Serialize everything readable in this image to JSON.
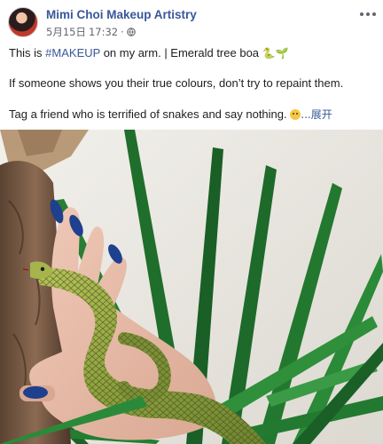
{
  "post": {
    "author": "Mimi Choi Makeup Artistry",
    "date": "5月15日",
    "time": "17:32",
    "separator": "·",
    "more_icon": "more-horizontal-icon",
    "privacy_icon": "globe-icon",
    "caption": {
      "line1_prefix": "This is ",
      "hashtag": "#MAKEUP",
      "line1_suffix": " on my arm. | Emerald tree boa ",
      "line1_emoji": "🐍🌱",
      "line2": "If someone shows you their true colours, don’t try to repaint them.",
      "line3": "Tag a friend who is terrified of snakes and say nothing. ",
      "ellipsis": "...",
      "see_more": "展开"
    },
    "photo": {
      "subject": "hand painted as an emerald tree boa wrapped around a plant"
    }
  },
  "colors": {
    "link": "#385898",
    "meta_text": "#616770",
    "snake_green": "#9aaa45",
    "nail_blue": "#1f3f8f",
    "leaf_green": "#1f6b2a"
  }
}
